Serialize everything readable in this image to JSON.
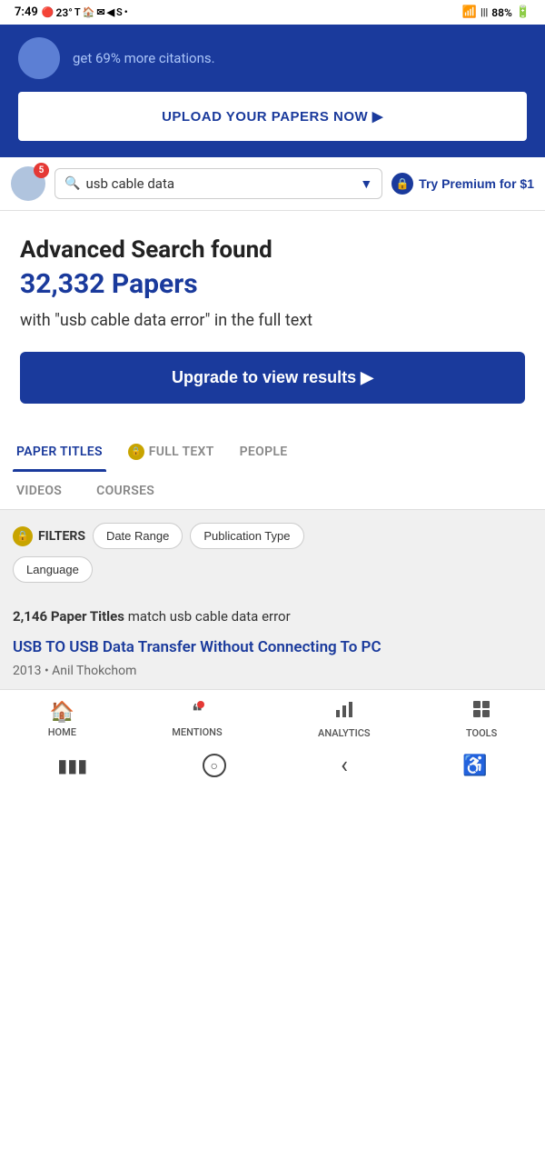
{
  "statusBar": {
    "time": "7:49",
    "temp": "23°",
    "battery": "88%",
    "notifications": "●"
  },
  "banner": {
    "text": "get 69% more citations.",
    "uploadBtn": "UPLOAD YOUR PAPERS NOW ▶"
  },
  "searchBar": {
    "avatarBadge": "5",
    "searchValue": "usb cable data",
    "premiumText": "Try Premium for $1"
  },
  "results": {
    "foundLabel": "Advanced Search found",
    "count": "32,332 Papers",
    "description": "with \"usb cable data error\" in the full text",
    "upgradeBtn": "Upgrade to view results ▶"
  },
  "tabs": {
    "row1": [
      {
        "label": "PAPER TITLES",
        "active": true,
        "locked": false
      },
      {
        "label": "FULL TEXT",
        "active": false,
        "locked": true
      },
      {
        "label": "PEOPLE",
        "active": false,
        "locked": false
      }
    ],
    "row2": [
      {
        "label": "VIDEOS",
        "active": false
      },
      {
        "label": "COURSES",
        "active": false
      }
    ]
  },
  "filters": {
    "label": "FILTERS",
    "chips": [
      "Date Range",
      "Publication Type",
      "Language"
    ]
  },
  "paperResults": {
    "summary": "2,146 Paper Titles match usb cable data error",
    "summaryMatchBold": "Paper Titles",
    "summaryQuery": "usb cable data error",
    "firstResult": {
      "title": "USB TO USB Data Transfer Without Connecting To PC",
      "year": "2013",
      "author": "Anil Thokchom"
    }
  },
  "bottomNav": {
    "items": [
      {
        "label": "HOME",
        "icon": "🏠",
        "active": false
      },
      {
        "label": "MENTIONS",
        "icon": "❝",
        "active": false,
        "hasDot": true
      },
      {
        "label": "ANALYTICS",
        "icon": "📊",
        "active": false
      },
      {
        "label": "TOOLS",
        "icon": "⊞",
        "active": false
      }
    ]
  },
  "systemNav": {
    "back": "‹",
    "home": "○",
    "recent": "▮▮▮"
  }
}
